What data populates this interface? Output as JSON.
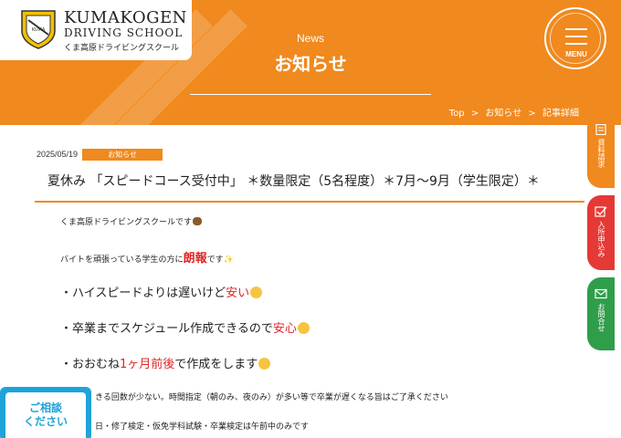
{
  "header": {
    "brand_en": "KUMAKOGEN",
    "brand_sub": "DRIVING SCHOOL",
    "brand_jp": "くま高原ドライビングスクール",
    "section_en": "News",
    "section_jp": "お知らせ",
    "menu_label": "MENU",
    "accent_color": "#f0891e"
  },
  "breadcrumb": {
    "items": [
      "Top",
      "お知らせ",
      "記事詳細"
    ],
    "separator": ">"
  },
  "article": {
    "date": "2025/05/19",
    "category": "お知らせ",
    "title": "夏休み 「スピードコース受付中」 ＊数量限定（5名程度）＊7月～9月（学生限定）＊",
    "lines": {
      "l1": "くま高原ドライビングスクールです",
      "l2a": "バイトを頑張っている学生の方に",
      "l2b": "朗報",
      "l2c": "です",
      "l3a": "・ハイスピードよりは遅いけど",
      "l3b": "安い",
      "l4a": "・卒業までスケジュール作成できるので",
      "l4b": "安心",
      "l5a": "・おおむね",
      "l5b": "1ヶ月前後",
      "l5c": "で作成をします",
      "l6": "きる回数が少ない。時間指定（朝のみ、夜のみ）が多い等で卒業が遅くなる旨はご了承ください",
      "l7": "日・修了検定・仮免学科試験・卒業検定は午前中のみです"
    }
  },
  "side_tabs": [
    {
      "label": "資料請求",
      "color": "#f0891e",
      "icon": "document-icon"
    },
    {
      "label": "入所申込み",
      "color": "#e53935",
      "icon": "checkbox-icon"
    },
    {
      "label": "お問合せ",
      "color": "#2e9e4a",
      "icon": "mail-icon"
    }
  ],
  "consult": {
    "line1": "ご相談",
    "line2": "ください",
    "color": "#1fa3d8"
  }
}
